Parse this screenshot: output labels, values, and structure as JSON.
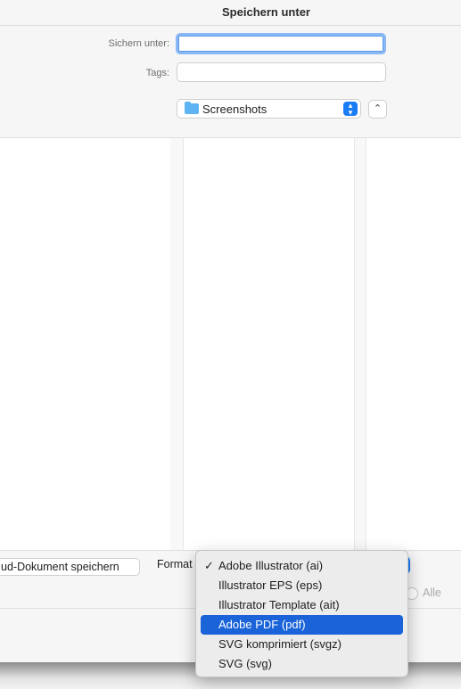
{
  "dialog": {
    "title": "Speichern unter"
  },
  "form": {
    "save_as_label": "Sichern unter:",
    "save_as_value": "",
    "tags_label": "Tags:",
    "tags_value": "",
    "location": "Screenshots"
  },
  "bottom": {
    "cloud_button": "ud-Dokument speichern",
    "format_label": "Format",
    "all_label": "Alle"
  },
  "format_menu": {
    "items": [
      {
        "label": "Adobe Illustrator (ai)",
        "checked": true,
        "highlighted": false
      },
      {
        "label": "Illustrator EPS (eps)",
        "checked": false,
        "highlighted": false
      },
      {
        "label": "Illustrator Template (ait)",
        "checked": false,
        "highlighted": false
      },
      {
        "label": "Adobe PDF (pdf)",
        "checked": false,
        "highlighted": true
      },
      {
        "label": "SVG komprimiert (svgz)",
        "checked": false,
        "highlighted": false
      },
      {
        "label": "SVG (svg)",
        "checked": false,
        "highlighted": false
      }
    ],
    "check_glyph": "✓"
  },
  "colors": {
    "accent": "#1a7cf5",
    "highlight": "#1a63d8",
    "folder": "#5eb3f3"
  }
}
